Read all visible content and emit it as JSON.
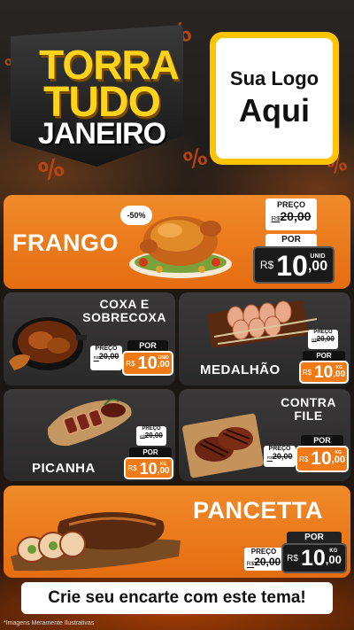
{
  "header": {
    "title_line1": "TORRA",
    "title_line2": "TUDO",
    "title_line3": "JANEIRO",
    "logo_line1": "Sua Logo",
    "logo_line2": "Aqui"
  },
  "products": {
    "frango": {
      "name": "FRANGO",
      "discount": "-50%",
      "preco_label": "PREÇO",
      "old_currency": "R$",
      "old_price": "20,00",
      "por_label": "POR",
      "currency": "R$",
      "price_int": "10",
      "price_dec": ",00",
      "unit": "UNID",
      "image": "roast-chicken"
    },
    "coxa": {
      "name_l1": "COXA E",
      "name_l2": "SOBRECOXA",
      "preco_label": "PREÇO",
      "old_currency": "R$",
      "old_price": "20,00",
      "por_label": "POR",
      "currency": "R$",
      "price_int": "10",
      "price_dec": ",00",
      "unit": "UNID",
      "image": "chicken-thighs-pan"
    },
    "medalhao": {
      "name": "MEDALHÃO",
      "preco_label": "PREÇO",
      "old_currency": "R$",
      "old_price": "20,00",
      "por_label": "POR",
      "currency": "R$",
      "price_int": "10",
      "price_dec": ",00",
      "unit": "KG",
      "image": "bacon-medallion-skewers"
    },
    "picanha": {
      "name": "PICANHA",
      "preco_label": "PREÇO",
      "old_currency": "R$",
      "old_price": "20,00",
      "por_label": "POR",
      "currency": "R$",
      "price_int": "10",
      "price_dec": ",00",
      "unit": "KG",
      "image": "sliced-picanha-board"
    },
    "contrafile": {
      "name_l1": "CONTRA",
      "name_l2": "FILE",
      "preco_label": "PREÇO",
      "old_currency": "R$",
      "old_price": "20,00",
      "por_label": "POR",
      "currency": "R$",
      "price_int": "10",
      "price_dec": ",00",
      "unit": "KG",
      "image": "grilled-steaks-board"
    },
    "pancetta": {
      "name": "PANCETTA",
      "preco_label": "PREÇO",
      "old_currency": "R$",
      "old_price": "20,00",
      "por_label": "POR",
      "currency": "R$",
      "price_int": "10",
      "price_dec": ",00",
      "unit": "KG",
      "image": "rolled-pancetta-board"
    }
  },
  "cta": "Crie seu encarte com este tema!",
  "disclaimer": "*Imagens Meramente Ilustrativas",
  "colors": {
    "accent_orange": "#ef7a16",
    "title_yellow": "#ffd319",
    "logo_border": "#ffc400",
    "dark_card": "#323030"
  }
}
